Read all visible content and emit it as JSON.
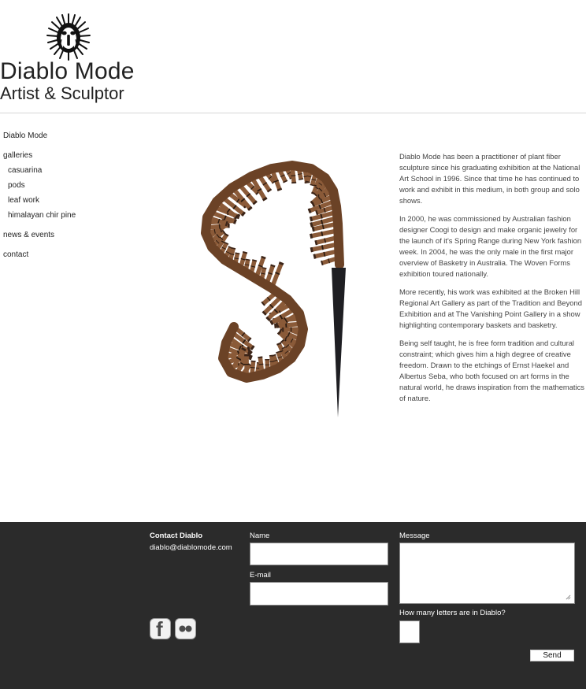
{
  "header": {
    "logo_icon": "mandrill-face-logo-icon",
    "title": "Diablo Mode",
    "subtitle": "Artist & Sculptor"
  },
  "nav": {
    "home": "Diablo Mode",
    "galleries": "galleries",
    "gallery_items": [
      "casuarina",
      "pods",
      "leaf work",
      "himalayan chir pine"
    ],
    "news": "news & events",
    "contact": "contact"
  },
  "artwork": {
    "icon": "woven-fiber-sculpture-image"
  },
  "bio": {
    "paragraphs": [
      "Diablo Mode has been a practitioner of plant fiber sculpture since his graduating exhibition at the National Art School in 1996. Since that time he has continued to work and exhibit in this medium, in both group and solo shows.",
      "In 2000, he was commissioned by Australian fashion designer Coogi to design and make organic jewelry for the launch of it's Spring Range during New York fashion week. In 2004, he was the only male in the first major overview of Basketry in Australia. The Woven Forms exhibition toured nationally.",
      "More recently, his work was exhibited at the Broken Hill Regional Art Gallery as part of the Tradition and Beyond Exhibition and at The Vanishing Point Gallery in a show highlighting contemporary baskets and basketry.",
      "Being self taught, he is free form tradition and cultural constraint; which gives him a high degree of creative freedom. Drawn to the etchings of Ernst Haekel and Albertus Seba, who both focused on art forms in the natural world, he draws inspiration from the mathematics of nature."
    ]
  },
  "footer": {
    "contact_title": "Contact Diablo",
    "email": "diablo@diablomode.com",
    "name_label": "Name",
    "name_value": "",
    "email_label": "E-mail",
    "email_value": "",
    "message_label": "Message",
    "message_value": "",
    "captcha_label": "How many letters are in Diablo?",
    "captcha_value": "",
    "send_label": "Send",
    "social": [
      "facebook-icon",
      "flickr-icon"
    ],
    "facebook_glyph": "f"
  },
  "colors": {
    "footer_bg": "#2b2b2b",
    "text": "#222222",
    "bio_text": "#444444",
    "flickr_blue": "#0063dc",
    "flickr_pink": "#ff0084"
  }
}
